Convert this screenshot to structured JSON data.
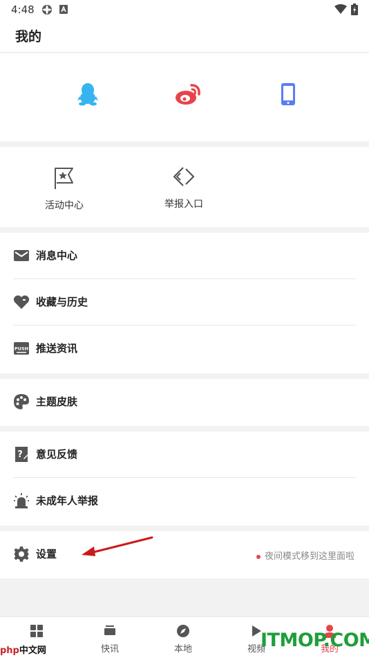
{
  "status_bar": {
    "time": "4:48"
  },
  "header": {
    "title": "我的"
  },
  "login": {
    "icons": [
      "qq-icon",
      "weibo-icon",
      "phone-icon"
    ]
  },
  "activity": {
    "items": [
      {
        "label": "活动中心",
        "icon": "flag-star-icon"
      },
      {
        "label": "举报入口",
        "icon": "report-icon"
      }
    ]
  },
  "menu": {
    "message_center": "消息中心",
    "favorites_history": "收藏与历史",
    "push_news": "推送资讯",
    "theme_skin": "主题皮肤",
    "feedback": "意见反馈",
    "minor_report": "未成年人举报",
    "settings": "设置",
    "settings_note": "夜间模式移到这里面啦"
  },
  "tabbar": {
    "items": [
      {
        "label": "",
        "icon": "grid-icon"
      },
      {
        "label": "快讯",
        "icon": "news-icon"
      },
      {
        "label": "本地",
        "icon": "compass-icon"
      },
      {
        "label": "视频",
        "icon": "play-icon"
      },
      {
        "label": "我的",
        "icon": "person-icon",
        "active": true
      }
    ]
  },
  "watermarks": {
    "left_php": "php",
    "left_cn": "中文网",
    "right": "ITMOP.COM"
  },
  "colors": {
    "accent": "#e8434a",
    "qq": "#36b4f0",
    "weibo": "#e8434a",
    "phone": "#5a7df5",
    "icon_gray": "#555555"
  }
}
